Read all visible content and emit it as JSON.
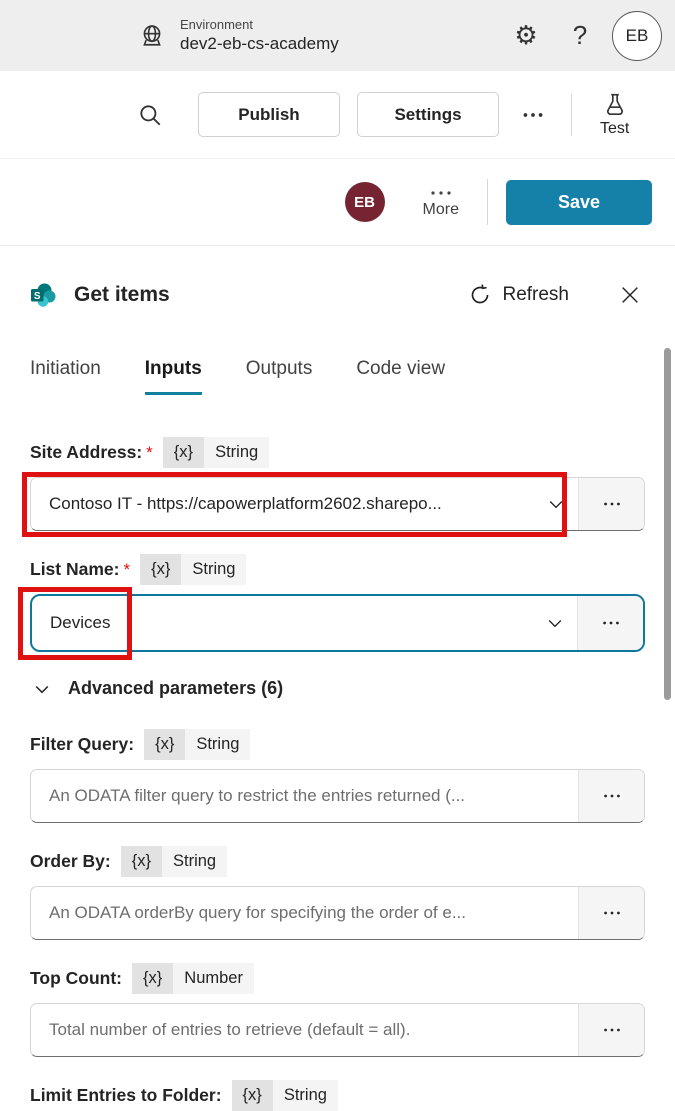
{
  "colors": {
    "accent_teal": "#1581a8",
    "focus_border": "#10789c",
    "tab_underline": "#11809e",
    "annotation_red": "#e01111",
    "avatar_maroon": "#772432",
    "topbar_bg": "#efeeee"
  },
  "topbar": {
    "environment_label": "Environment",
    "environment_name": "dev2-eb-cs-academy",
    "avatar_initials": "EB"
  },
  "toolbar": {
    "publish": "Publish",
    "settings": "Settings",
    "test": "Test"
  },
  "actionbar": {
    "avatar_initials": "EB",
    "more": "More",
    "save": "Save"
  },
  "panel": {
    "title": "Get items",
    "refresh": "Refresh",
    "tabs": {
      "initiation": "Initiation",
      "inputs": "Inputs",
      "outputs": "Outputs",
      "code_view": "Code view"
    },
    "fields": {
      "site_address": {
        "label": "Site Address:",
        "required": "*",
        "token": "{x}",
        "type": "String",
        "value": "Contoso IT - https://capowerplatform2602.sharepo..."
      },
      "list_name": {
        "label": "List Name:",
        "required": "*",
        "token": "{x}",
        "type": "String",
        "value": "Devices"
      },
      "advanced": {
        "label": "Advanced parameters (6)"
      },
      "filter_query": {
        "label": "Filter Query:",
        "token": "{x}",
        "type": "String",
        "placeholder": "An ODATA filter query to restrict the entries returned (..."
      },
      "order_by": {
        "label": "Order By:",
        "token": "{x}",
        "type": "String",
        "placeholder": "An ODATA orderBy query for specifying the order of e..."
      },
      "top_count": {
        "label": "Top Count:",
        "token": "{x}",
        "type": "Number",
        "placeholder": "Total number of entries to retrieve (default = all)."
      },
      "limit_entries": {
        "label": "Limit Entries to Folder:",
        "token": "{x}",
        "type": "String"
      }
    }
  }
}
